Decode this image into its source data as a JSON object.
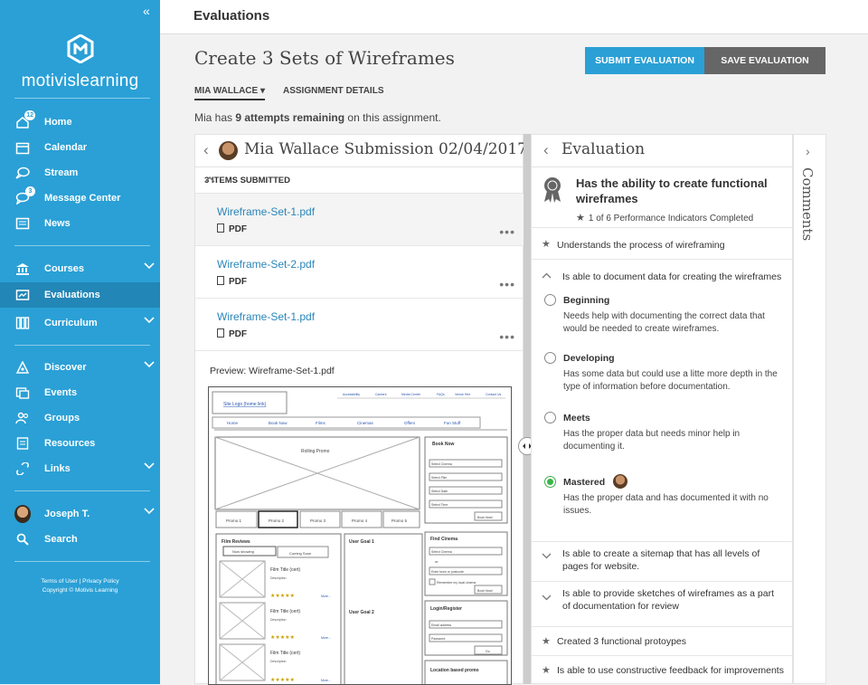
{
  "sidebar": {
    "collapse_icon": "«",
    "brand": "motivislearning",
    "items": [
      {
        "label": "Home",
        "icon": "home-icon",
        "badge": "12"
      },
      {
        "label": "Calendar",
        "icon": "calendar-icon"
      },
      {
        "label": "Stream",
        "icon": "stream-icon"
      },
      {
        "label": "Message Center",
        "icon": "message-icon",
        "badge": "3"
      },
      {
        "label": "News",
        "icon": "news-icon"
      },
      {
        "label": "Courses",
        "icon": "courses-icon"
      },
      {
        "label": "Evaluations",
        "icon": "evaluations-icon"
      },
      {
        "label": "Curriculum",
        "icon": "curriculum-icon"
      },
      {
        "label": "Discover",
        "icon": "discover-icon"
      },
      {
        "label": "Events",
        "icon": "events-icon"
      },
      {
        "label": "Groups",
        "icon": "groups-icon"
      },
      {
        "label": "Resources",
        "icon": "resources-icon"
      },
      {
        "label": "Links",
        "icon": "links-icon"
      },
      {
        "label": "Joseph T.",
        "icon": "avatar"
      },
      {
        "label": "Search",
        "icon": "search-icon"
      }
    ],
    "footer_line1": "Terms of User | Privacy Policy",
    "footer_line2": "Copyright © Motivis Learning"
  },
  "header": {
    "title": "Evaluations"
  },
  "page": {
    "title": "Create 3 Sets of Wireframes",
    "submit_label": "SUBMIT EVALUATION",
    "save_label": "SAVE EVALUATION",
    "tab_user": "MIA WALLACE ▾",
    "tab_details": "ASSIGNMENT DETAILS",
    "attempts_pre": "Mia has ",
    "attempts_bold": "9 attempts remaining",
    "attempts_post": " on this assignment."
  },
  "submission": {
    "title": "Mia Wallace Submission 02/04/2017",
    "items_label": "3 ITEMS SUBMITTED",
    "files": [
      {
        "name": "Wireframe-Set-1.pdf",
        "type": "PDF"
      },
      {
        "name": "Wireframe-Set-2.pdf",
        "type": "PDF"
      },
      {
        "name": "Wireframe-Set-1.pdf",
        "type": "PDF"
      }
    ],
    "more": "•••",
    "preview_label": "Preview: Wireframe-Set-1.pdf",
    "wireframe": {
      "site_logo": "Site Logo (home link)",
      "top_links": [
        "Accessibility",
        "Careers",
        "Media Centre",
        "FAQs",
        "Venue Hire",
        "Contact Us"
      ],
      "nav": [
        "Home",
        "Book Now",
        "Films",
        "Cinemas",
        "Offers",
        "Fun Stuff"
      ],
      "rolling": "Rolling Promo",
      "book_now": "Book Now",
      "book_selects": [
        "Select Cinema",
        "Select Film",
        "Select Date",
        "Select Time"
      ],
      "book_btn": "Book Now!",
      "promos": [
        "Promo 1",
        "Promo 2",
        "Promo 3",
        "Promo 4",
        "Promo 5"
      ],
      "film_reviews": "Film Reviews",
      "now_showing": "Now showing",
      "coming_soon": "Coming Soon",
      "film_title": "Film Title (cert)",
      "description": "Description",
      "more_link": "More...",
      "stars": "★★★★★",
      "goal1": "User Goal 1",
      "goal2": "User Goal 2",
      "find_cinema": "Find Cinema",
      "select_cinema": "Select Cinema",
      "or": "or",
      "town": "Enter town or postcode",
      "remember": "Remember my local cinema",
      "login": "Login/Register",
      "email": "Email address",
      "password": "Password",
      "go": "Go",
      "location_promo": "Location based promo"
    }
  },
  "evaluation": {
    "title": "Evaluation",
    "competency": "Has the ability to create functional wireframes",
    "progress": "1 of 6 Performance Indicators Completed",
    "understands": "Understands the process of wireframing",
    "indicator": "Is able to document data for creating the wireframes",
    "levels": [
      {
        "name": "Beginning",
        "desc": "Needs help with documenting the correct data that would be needed to create wireframes."
      },
      {
        "name": "Developing",
        "desc": "Has some data but could use a litte more depth in the type of information before documentation."
      },
      {
        "name": "Meets",
        "desc": "Has the proper data but needs minor help in documenting it."
      },
      {
        "name": "Mastered",
        "desc": "Has the proper data and has documented it with no issues."
      }
    ],
    "selected_level": "Mastered",
    "sitemap_line1": "Is able to create a sitemap that has all levels of",
    "sitemap_line2": "pages for website.",
    "sketches_line1": "Is able to provide sketches of wireframes as a part",
    "sketches_line2": "of documentation for review",
    "created": "Created 3 functional protoypes",
    "feedback": "Is able to use constructive feedback for improvements"
  },
  "comments": {
    "label": "Comments"
  },
  "colors": {
    "brand": "#2aa0d6",
    "save": "#666666",
    "selected": "#3cb34a"
  }
}
